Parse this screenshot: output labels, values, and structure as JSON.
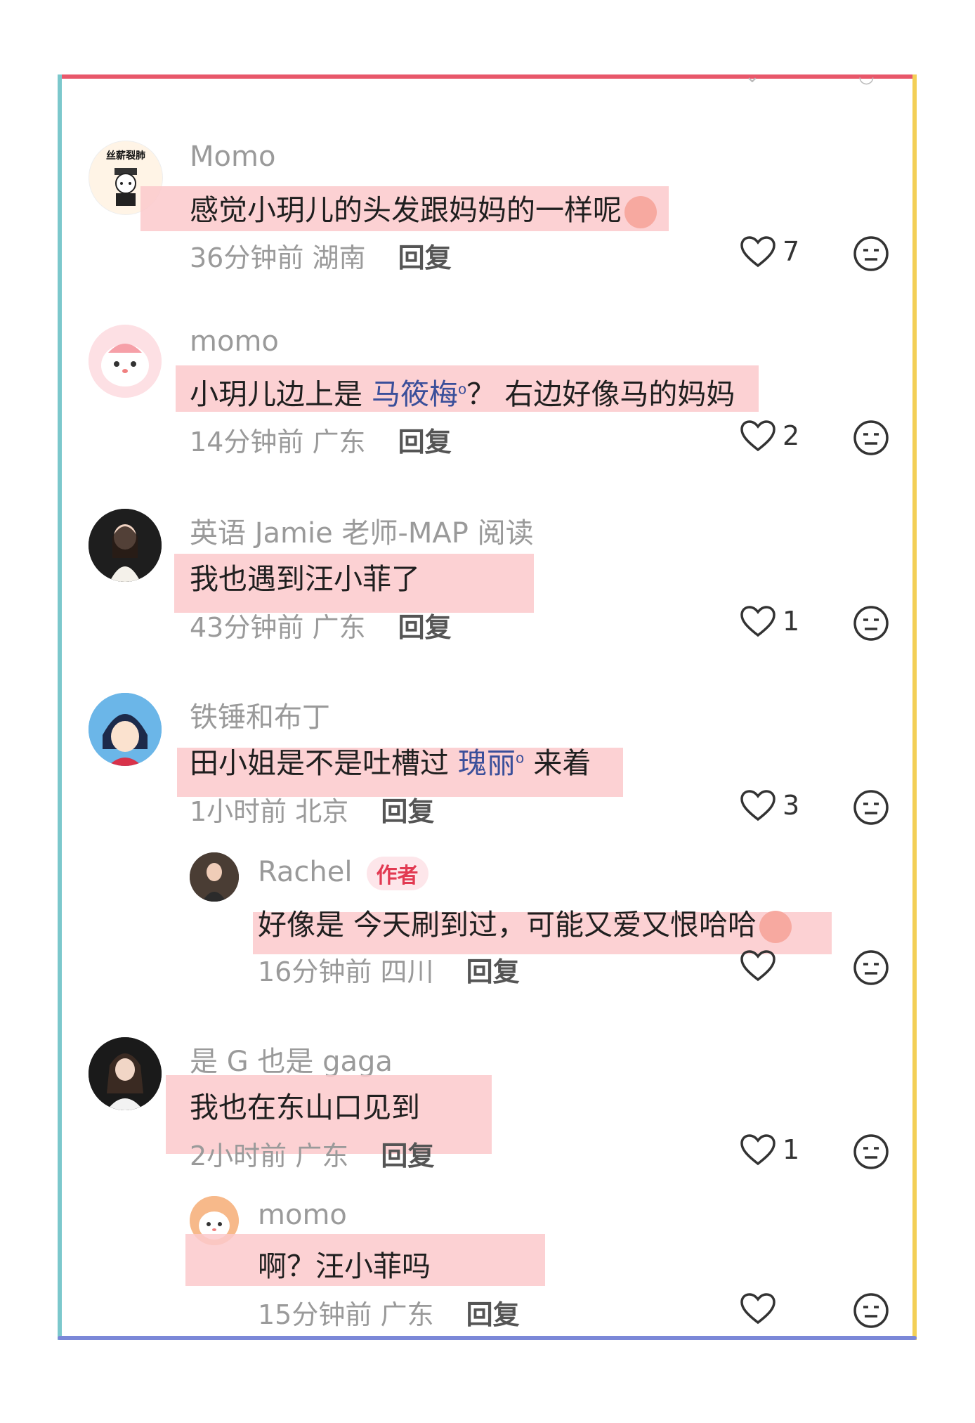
{
  "comments": [
    {
      "user": "Momo",
      "text": "感觉小玥儿的头发跟妈妈的一样呢",
      "time": "36分钟前",
      "location": "湖南",
      "reply": "回复",
      "likes": "7",
      "avatar_text": "丝薪裂肺"
    },
    {
      "user": "momo",
      "text_a": "小玥儿边上是 ",
      "link": "马筱梅",
      "text_b": "？ 右边好像马的妈妈",
      "time": "14分钟前",
      "location": "广东",
      "reply": "回复",
      "likes": "2"
    },
    {
      "user": "英语 Jamie 老师-MAP 阅读",
      "text": "我也遇到汪小菲了",
      "time": "43分钟前",
      "location": "广东",
      "reply": "回复",
      "likes": "1"
    },
    {
      "user": "铁锤和布丁",
      "text_a": "田小姐是不是吐槽过 ",
      "link": "瑰丽",
      "text_b": " 来着",
      "time": "1小时前",
      "location": "北京",
      "reply": "回复",
      "likes": "3"
    },
    {
      "user": "Rachel",
      "author_tag": "作者",
      "text": "好像是 今天刷到过，可能又爱又恨哈哈",
      "time": "16分钟前",
      "location": "四川",
      "reply": "回复",
      "likes": ""
    },
    {
      "user": "是 G 也是 gaga",
      "text": "我也在东山口见到",
      "time": "2小时前",
      "location": "广东",
      "reply": "回复",
      "likes": "1"
    },
    {
      "user": "momo",
      "text": "啊？汪小菲吗",
      "time": "15分钟前",
      "location": "广东",
      "reply": "回复",
      "likes": ""
    }
  ],
  "colors": {
    "frame_top": "#e8576a",
    "frame_left": "#7cc8cc",
    "frame_right": "#f3cf56",
    "frame_bottom": "#7b88d8",
    "highlight": "#fbc9cb",
    "link": "#3a4f9a",
    "author_tag": "#e23a52"
  },
  "icons": {
    "like": "heart-outline-icon",
    "react": "neutral-face-icon",
    "search": "search-icon"
  }
}
